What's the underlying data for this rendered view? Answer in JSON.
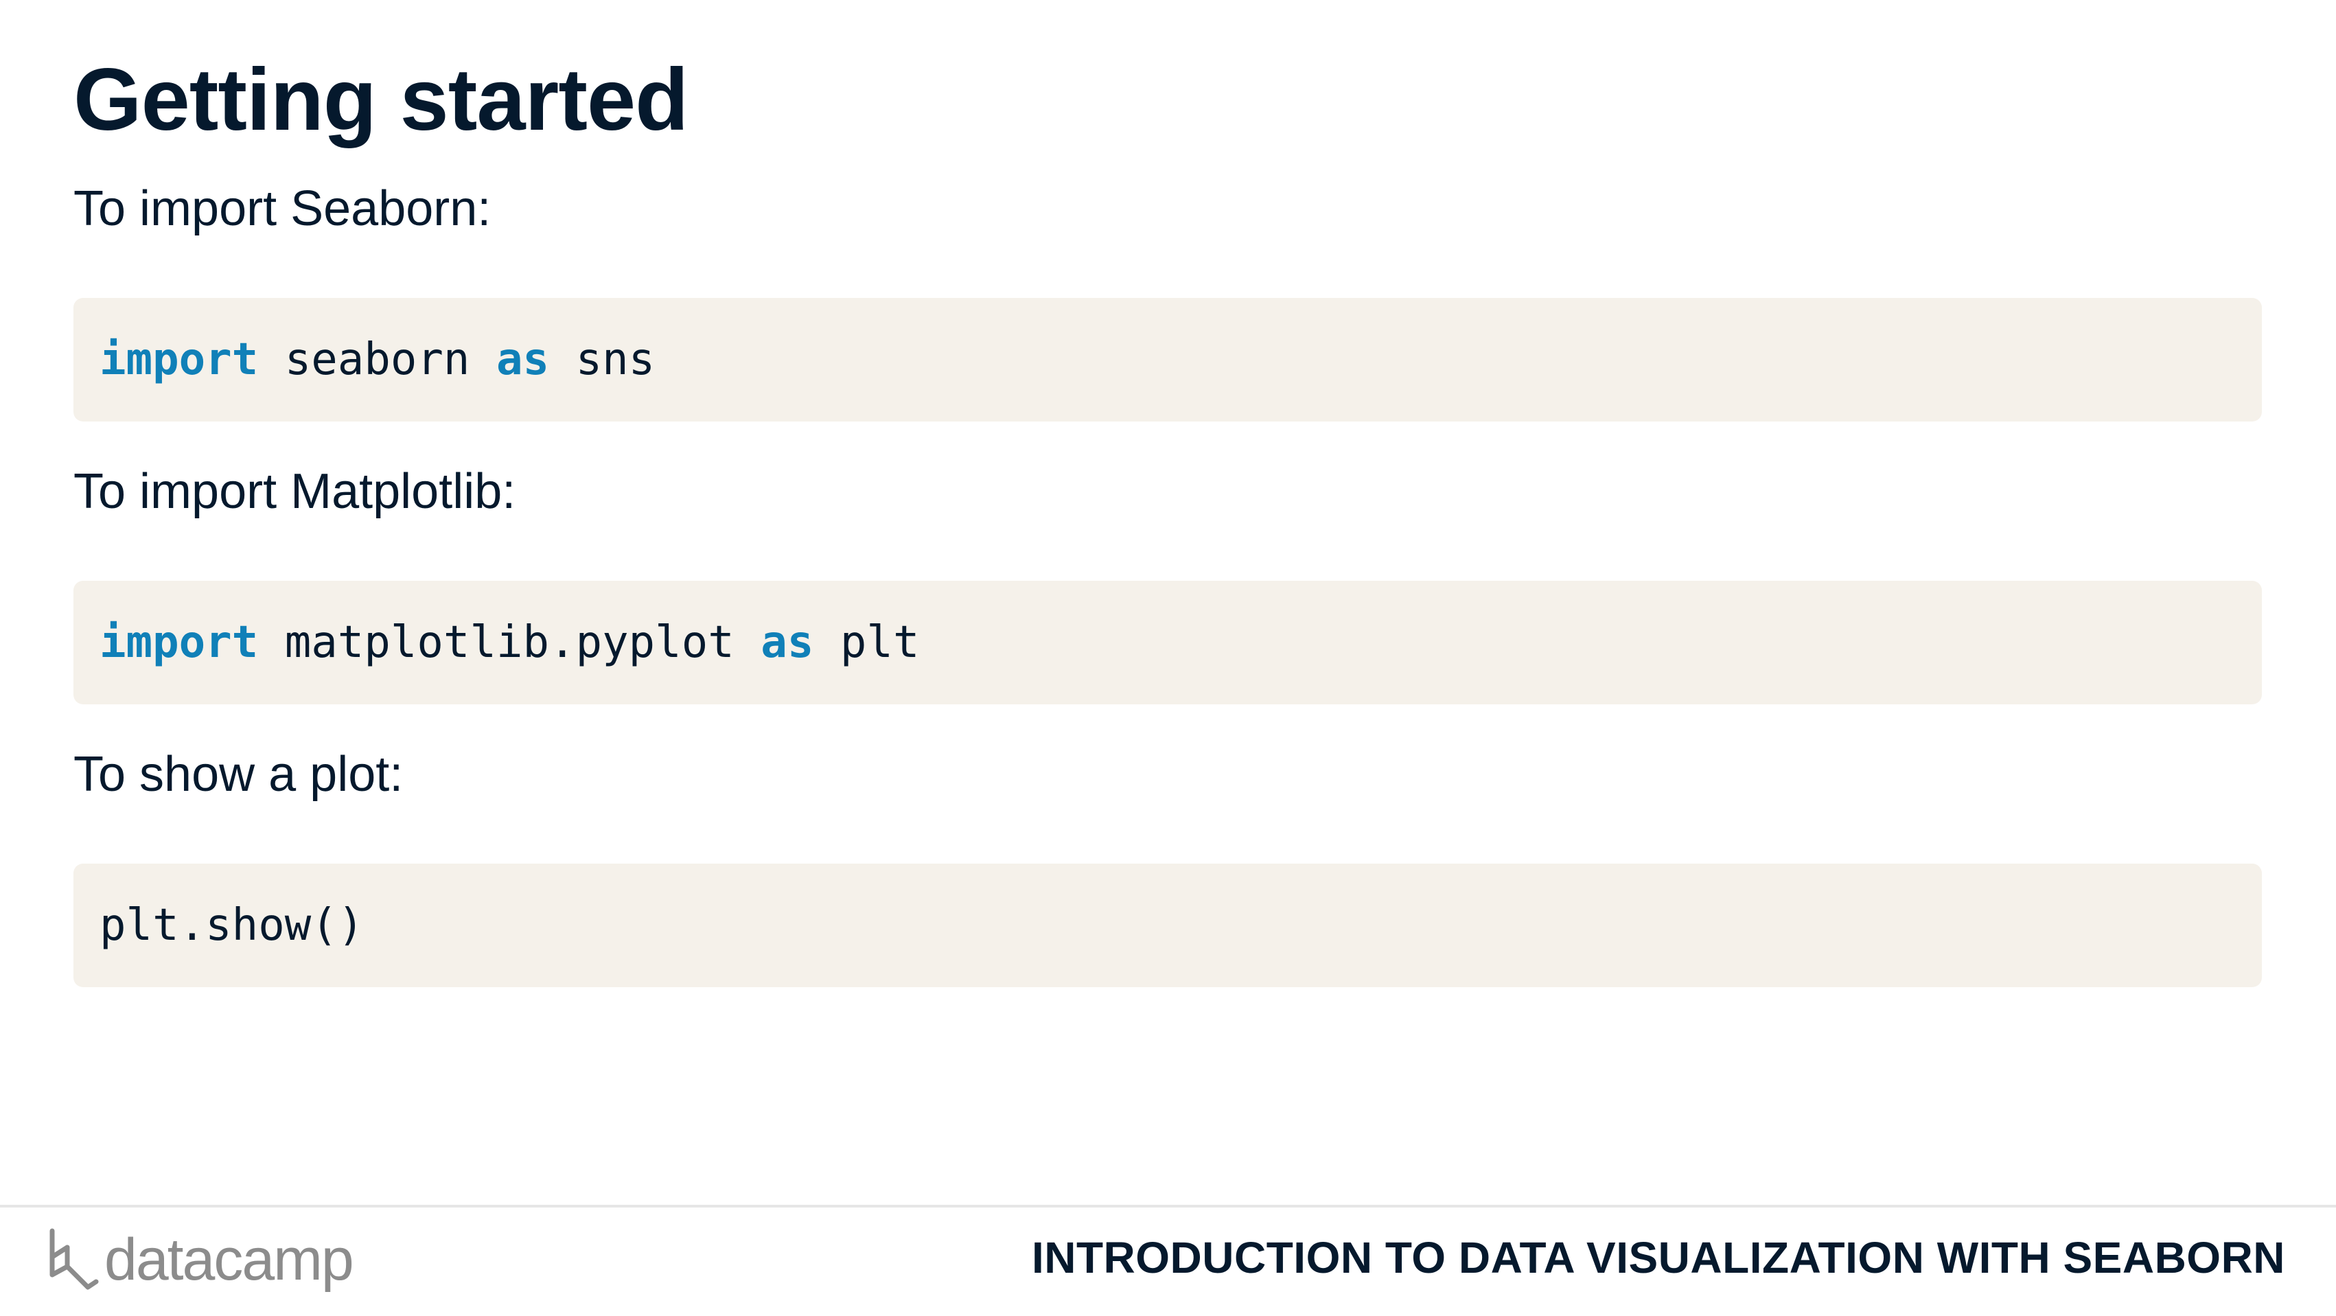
{
  "slide": {
    "title": "Getting started"
  },
  "sections": [
    {
      "label": "To import Seaborn:",
      "code": [
        {
          "text": "import",
          "keyword": true
        },
        {
          "text": " seaborn ",
          "keyword": false
        },
        {
          "text": "as",
          "keyword": true
        },
        {
          "text": " sns",
          "keyword": false
        }
      ]
    },
    {
      "label": "To import Matplotlib:",
      "code": [
        {
          "text": "import",
          "keyword": true
        },
        {
          "text": " matplotlib.pyplot ",
          "keyword": false
        },
        {
          "text": "as",
          "keyword": true
        },
        {
          "text": " plt",
          "keyword": false
        }
      ]
    },
    {
      "label": "To show a plot:",
      "code": [
        {
          "text": "plt.show()",
          "keyword": false
        }
      ]
    }
  ],
  "footer": {
    "logo_text": "datacamp",
    "logo_icon": "datacamp-logo-icon",
    "course_title": "INTRODUCTION TO DATA VISUALIZATION WITH SEABORN"
  },
  "colors": {
    "text": "#05192d",
    "keyword": "#1080b8",
    "code_background": "#f5f1ea",
    "logo_gray": "#8c8c8c"
  }
}
